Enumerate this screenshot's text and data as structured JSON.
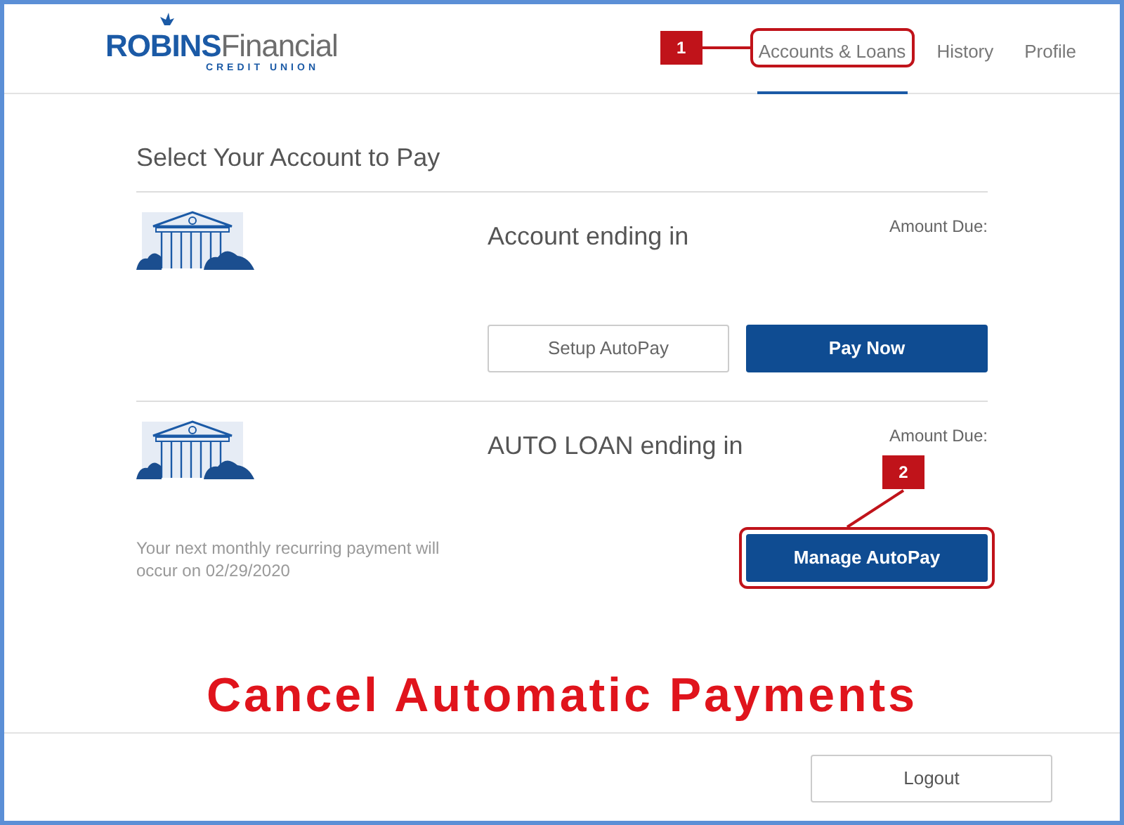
{
  "logo": {
    "primary": "ROBINS",
    "secondary": "Financial",
    "tagline": "CREDIT UNION"
  },
  "nav": [
    {
      "label": "Accounts & Loans",
      "selected": true,
      "callout": {
        "label": "1",
        "kind": "left"
      }
    },
    {
      "label": "History",
      "selected": false
    },
    {
      "label": "Profile",
      "selected": false
    }
  ],
  "title": "Select Your Account to Pay",
  "accounts": [
    {
      "name": "Account ending in",
      "amount_label": "Amount Due:",
      "buttons": [
        {
          "label": "Setup AutoPay",
          "kind": "outline"
        },
        {
          "label": "Pay Now",
          "kind": "primary"
        }
      ]
    },
    {
      "name": "AUTO LOAN ending in",
      "amount_label": "Amount Due:",
      "message": "Your next monthly recurring payment will occur on 02/29/2020",
      "buttons": [
        {
          "label": "Manage AutoPay",
          "kind": "primary",
          "callout": {
            "label": "2",
            "kind": "top"
          }
        }
      ]
    }
  ],
  "caption": "Cancel Automatic Payments",
  "logout": "Logout"
}
